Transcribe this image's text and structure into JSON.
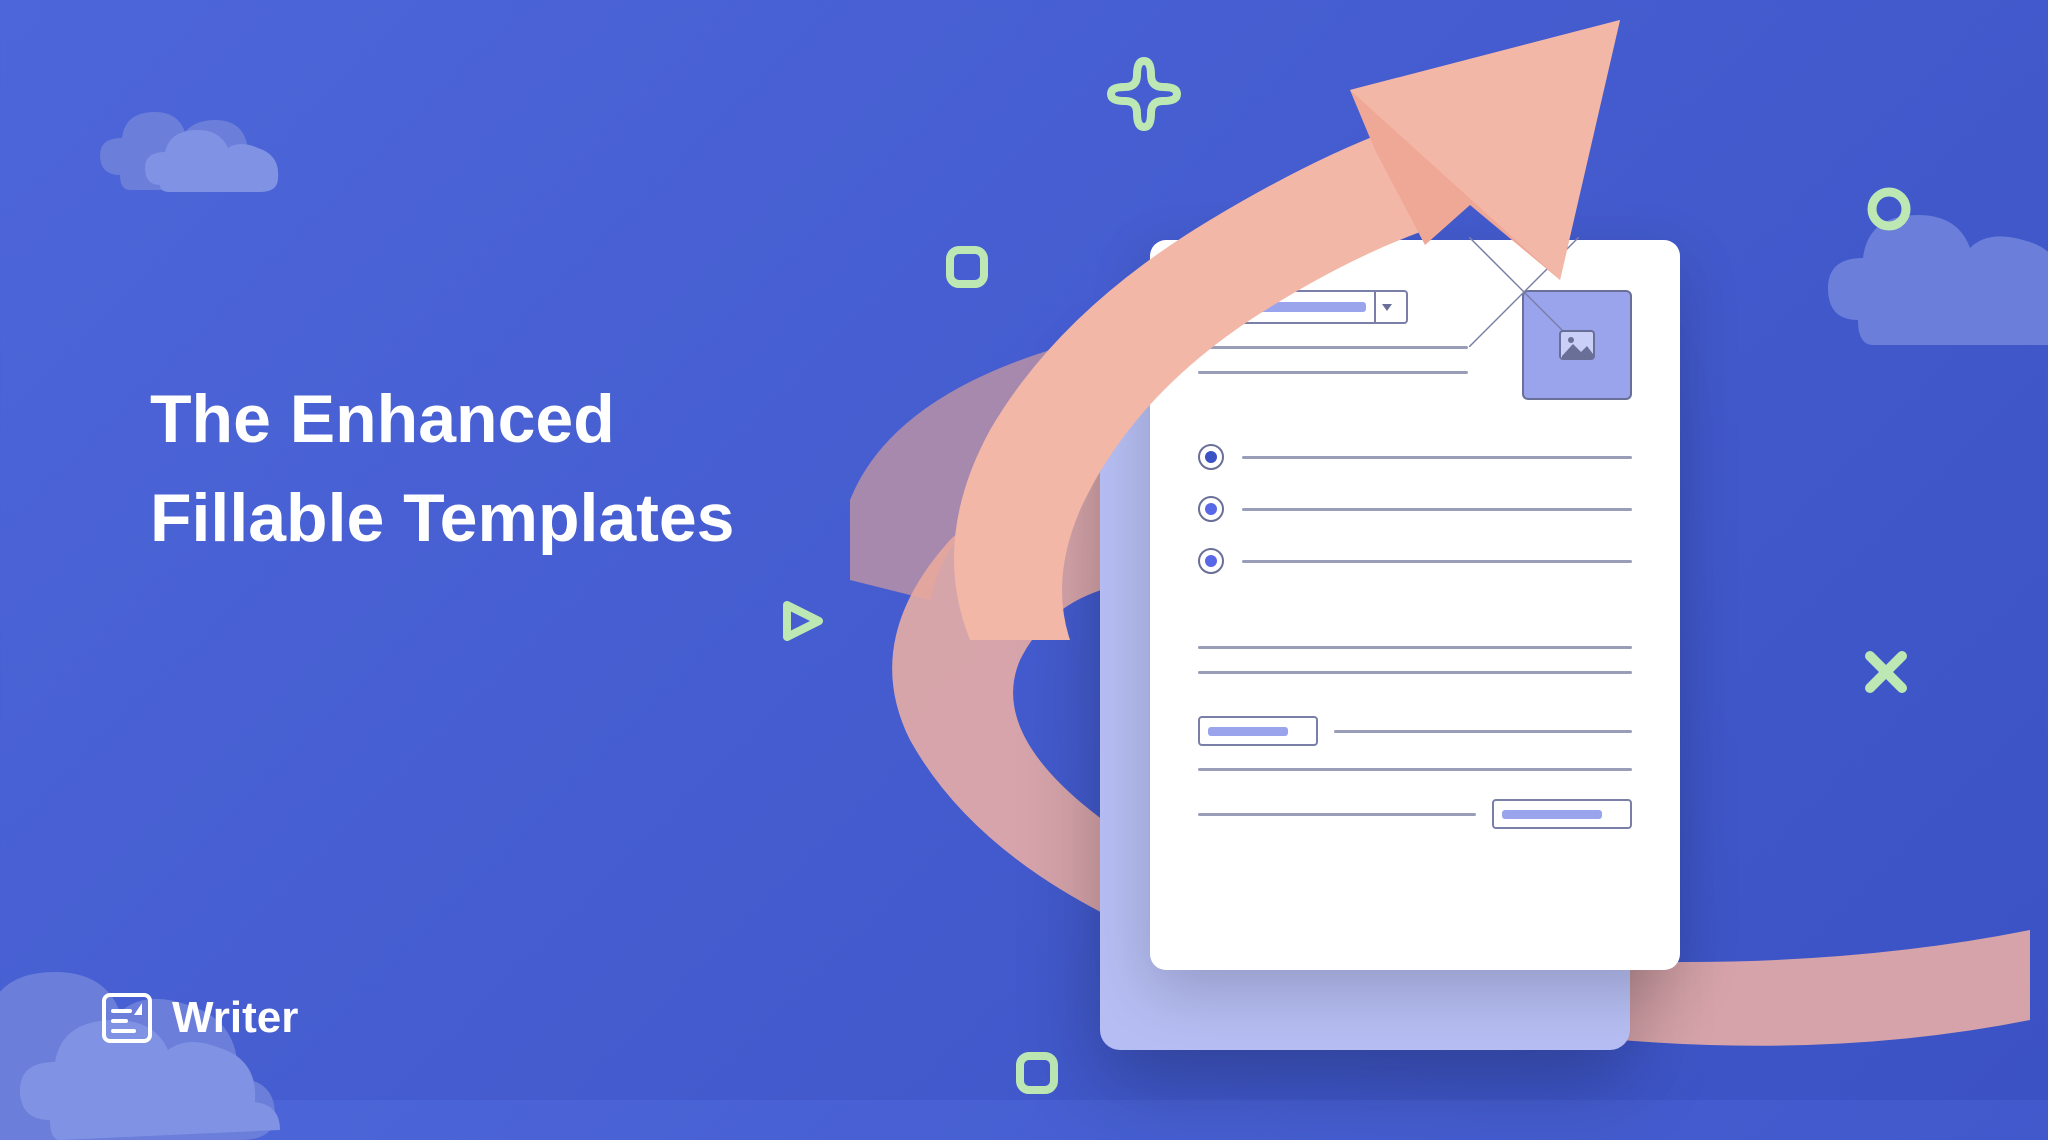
{
  "heading_line1": "The Enhanced",
  "heading_line2": "Fillable Templates",
  "brand": "Writer",
  "colors": {
    "bg_start": "#4d66d9",
    "bg_end": "#3b52c4",
    "accent_green": "#bde8b4",
    "ribbon": "#f3b7a7",
    "doc_back": "#b5bdf2",
    "field_fill": "#9aa4ed"
  }
}
